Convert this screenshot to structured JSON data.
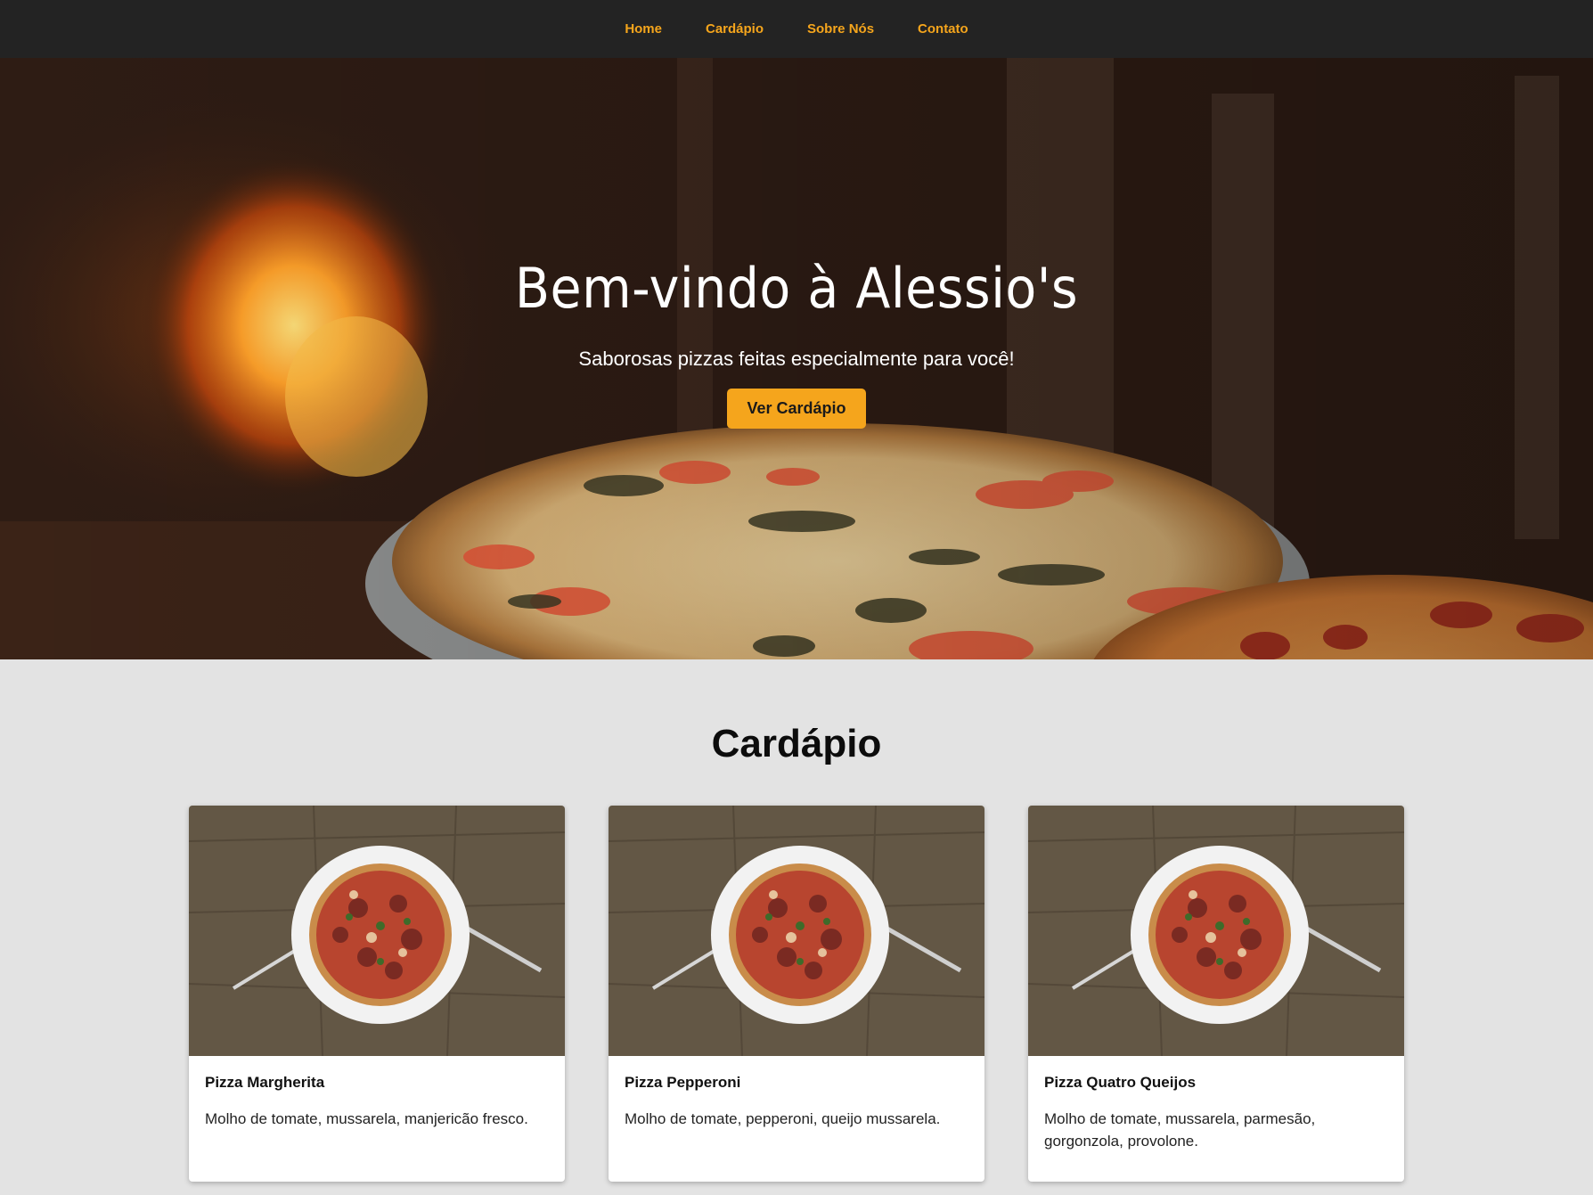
{
  "nav": {
    "items": [
      {
        "label": "Home"
      },
      {
        "label": "Cardápio"
      },
      {
        "label": "Sobre Nós"
      },
      {
        "label": "Contato"
      }
    ]
  },
  "hero": {
    "title": "Bem-vindo à Alessio's",
    "subtitle": "Saborosas pizzas feitas especialmente para você!",
    "button_label": "Ver Cardápio"
  },
  "menu": {
    "title": "Cardápio",
    "items": [
      {
        "name": "Pizza Margherita",
        "description": "Molho de tomate, mussarela, manjericão fresco."
      },
      {
        "name": "Pizza Pepperoni",
        "description": "Molho de tomate, pepperoni, queijo mussarela."
      },
      {
        "name": "Pizza Quatro Queijos",
        "description": "Molho de tomate, mussarela, parmesão, gorgonzola, provolone."
      }
    ]
  },
  "colors": {
    "accent": "#f5a51c",
    "nav_bg": "#232323",
    "page_bg": "#e3e3e3"
  }
}
